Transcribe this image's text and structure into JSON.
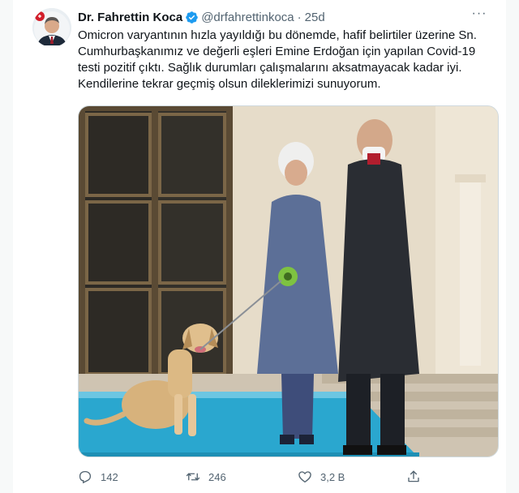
{
  "tweet": {
    "author_name": "Dr. Fahrettin Koca",
    "handle": "@drfahrettinkoca",
    "separator": "·",
    "time": "25d",
    "more": "···",
    "lines": [
      "Omicron varyantının hızla yayıldığı bu dönemde, hafif belirtiler üzerine Sn.",
      "Cumhurbaşkanımız ve değerli eşleri Emine Erdoğan için yapılan Covid-19",
      "testi pozitif çıktı. Sağlık durumları çalışmalarını aksatmayacak kadar iyi.",
      "Kendilerine tekrar geçmiş olsun dileklerimizi sunuyorum."
    ]
  },
  "actions": {
    "reply_count": "142",
    "retweet_count": "246",
    "like_count": "3,2 B"
  },
  "colors": {
    "text": "#0f1419",
    "secondary": "#536471",
    "verified": "#1d9bf0",
    "carpet": "#2aa7cf"
  },
  "icons": [
    "verified-badge-icon",
    "more-icon",
    "reply-icon",
    "retweet-icon",
    "like-icon",
    "share-icon"
  ]
}
